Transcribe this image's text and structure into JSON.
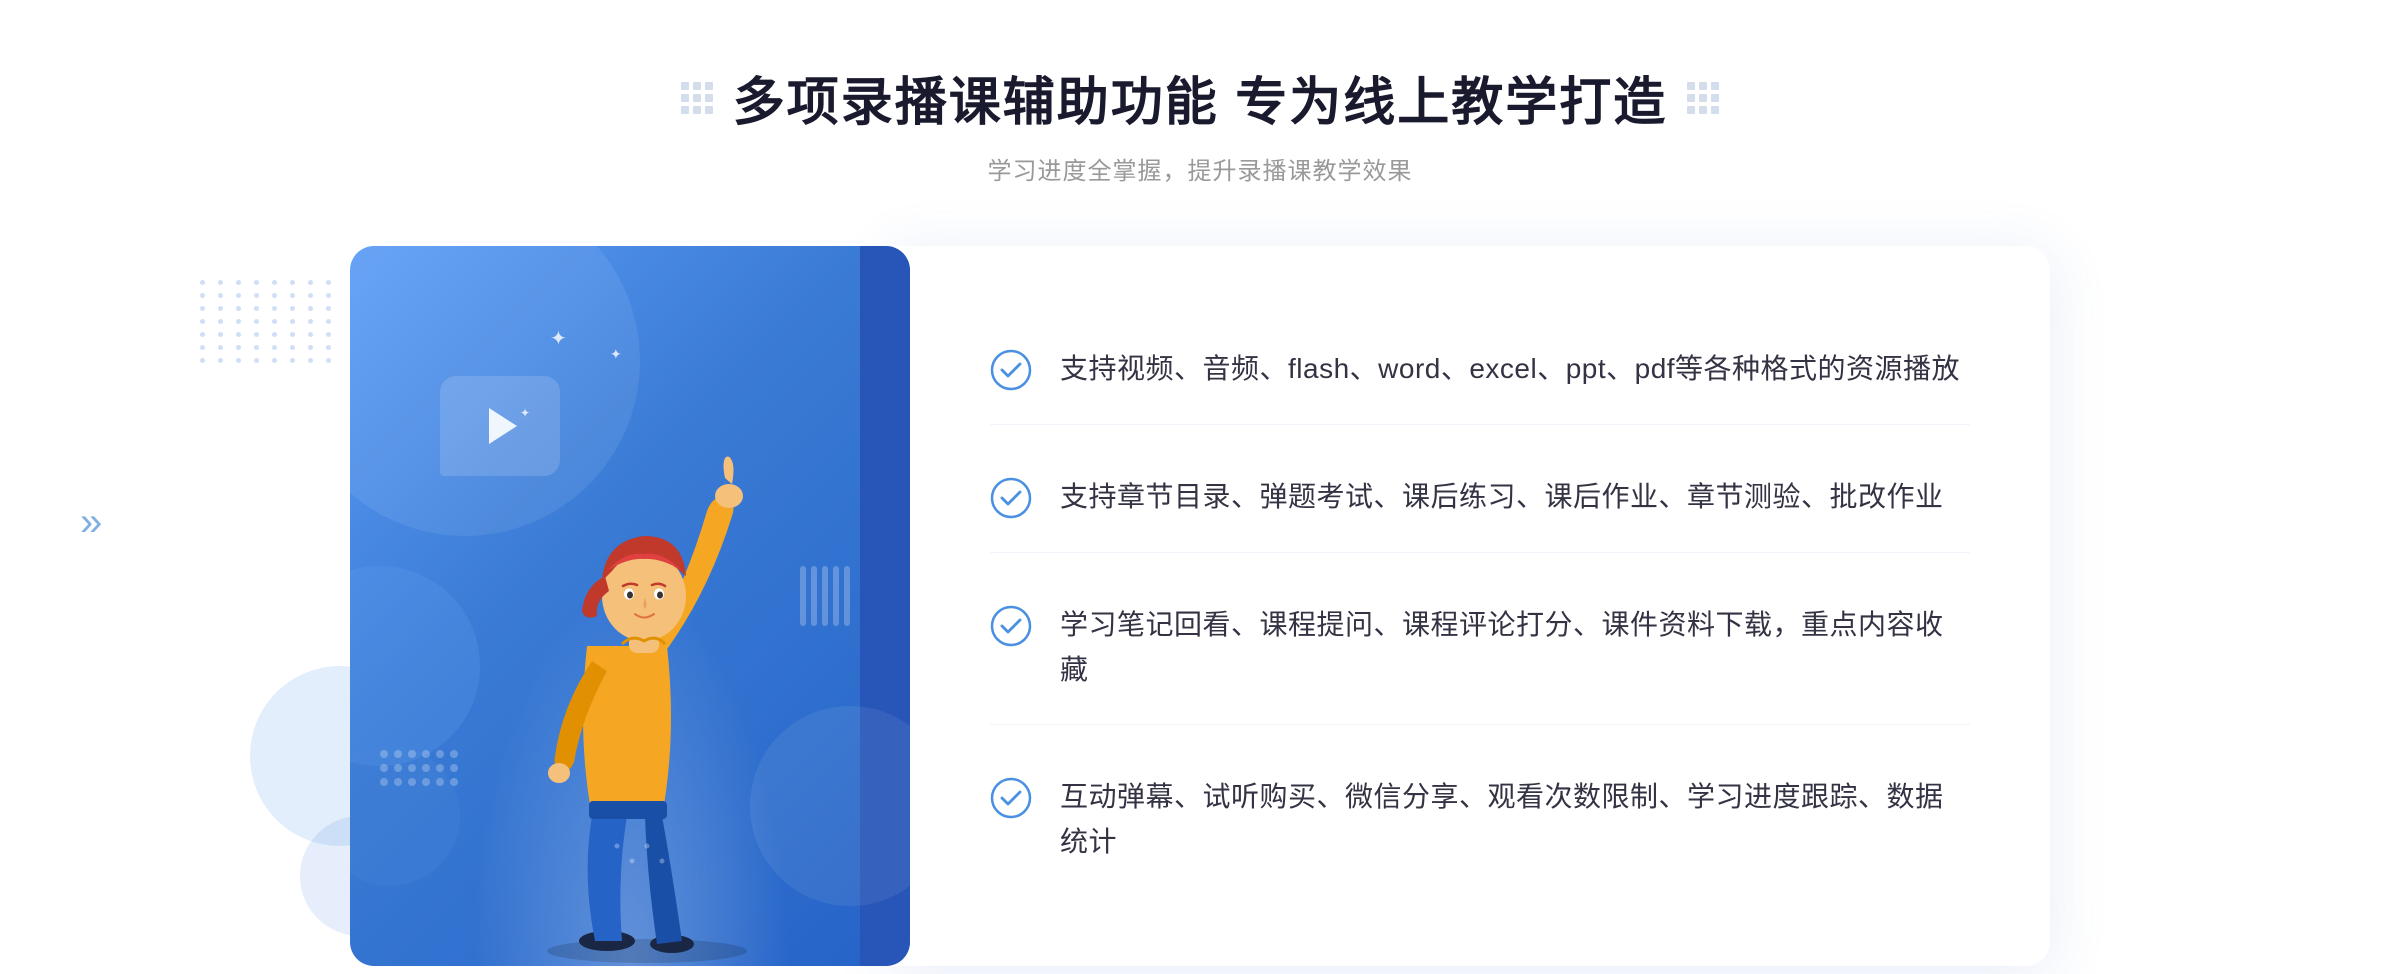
{
  "header": {
    "title": "多项录播课辅助功能 专为线上教学打造",
    "subtitle": "学习进度全掌握，提升录播课教学效果"
  },
  "features": [
    {
      "id": 1,
      "text": "支持视频、音频、flash、word、excel、ppt、pdf等各种格式的资源播放"
    },
    {
      "id": 2,
      "text": "支持章节目录、弹题考试、课后练习、课后作业、章节测验、批改作业"
    },
    {
      "id": 3,
      "text": "学习笔记回看、课程提问、课程评论打分、课件资料下载，重点内容收藏"
    },
    {
      "id": 4,
      "text": "互动弹幕、试听购买、微信分享、观看次数限制、学习进度跟踪、数据统计"
    }
  ],
  "colors": {
    "accent_blue": "#3a7bd5",
    "light_blue": "#5b9cf6",
    "dark_blue": "#2563c7",
    "check_circle_color": "#4a90e2",
    "text_dark": "#333344",
    "text_gray": "#999999"
  }
}
